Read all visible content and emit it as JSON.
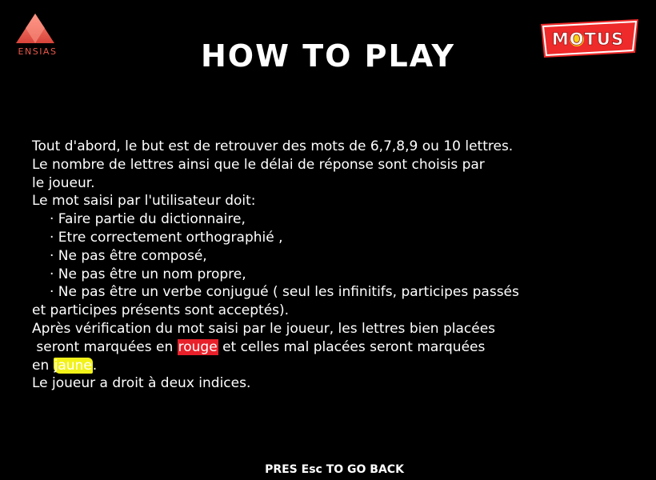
{
  "logos": {
    "ensias_text": "ENSIAS",
    "motus_text": "MOTUS"
  },
  "title": "HOW TO PLAY",
  "instructions": {
    "line1": "Tout d'abord, le but est de retrouver des mots de 6,7,8,9 ou 10 lettres.",
    "line2": "Le nombre de lettres ainsi que le délai de réponse sont choisis par",
    "line3": "le joueur.",
    "line4": "Le mot saisi par l'utilisateur doit:",
    "rules": [
      "· Faire partie du dictionnaire,",
      "· Etre correctement orthographié ,",
      "· Ne pas être composé,",
      "· Ne pas être un nom propre,",
      "· Ne pas être un verbe conjugué ( seul les infinitifs, participes passés"
    ],
    "line_cont": "et participes présents sont acceptés).",
    "line_after1": "Après vérification du mot saisi par le joueur, les lettres bien placées",
    "line_after2_pre": " seront marquées en ",
    "red_word": "rouge",
    "line_after2_post": " et celles mal placées seront marquées",
    "line_after3_pre": "en ",
    "yellow_word": "jaune",
    "line_after3_post": ".",
    "line_last": "Le joueur a droit à deux indices."
  },
  "footer": "PRES Esc TO GO BACK",
  "colors": {
    "background": "#000000",
    "text": "#ffffff",
    "red_highlight": "#e8202a",
    "yellow_highlight": "#f2f21a",
    "ensias_accent": "#e8584a",
    "motus_red": "#ee2a2a"
  }
}
